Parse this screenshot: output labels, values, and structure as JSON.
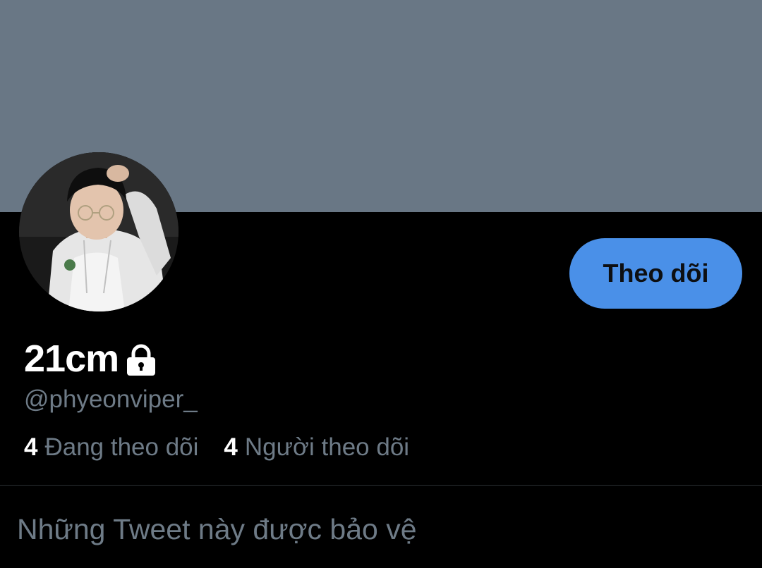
{
  "profile": {
    "display_name": "21cm",
    "handle": "@phyeonviper_",
    "follow_label": "Theo dõi",
    "following_count": "4",
    "following_label": "Đang theo dõi",
    "followers_count": "4",
    "followers_label": "Người theo dõi",
    "protected_notice": "Những Tweet này được bảo vệ"
  },
  "icons": {
    "lock": "lock-icon"
  },
  "colors": {
    "banner": "#697785",
    "background": "#000000",
    "accent": "#4a90e8",
    "muted_text": "#6e7b87"
  }
}
